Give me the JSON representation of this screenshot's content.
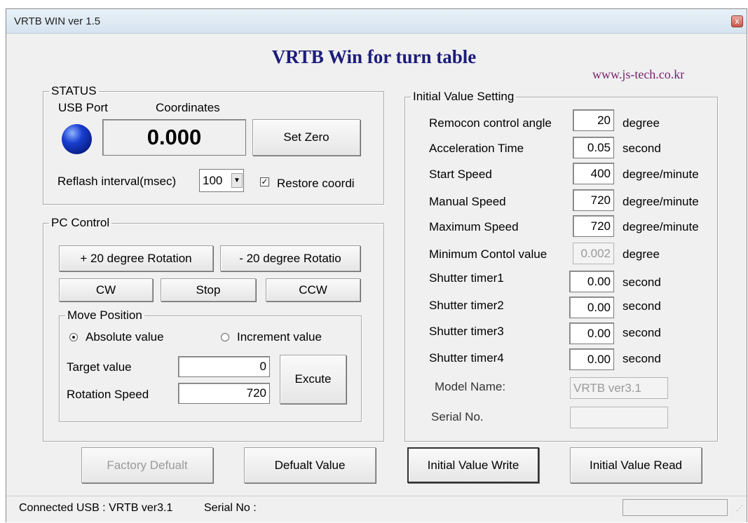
{
  "window": {
    "title": "VRTB WIN  ver 1.5",
    "close_glyph": "x"
  },
  "heading": "VRTB Win for turn table",
  "website": "www.js-tech.co.kr",
  "status": {
    "legend": "STATUS",
    "usb_port_label": "USB Port",
    "coordinates_label": "Coordinates",
    "coordinates_value": "0.000",
    "set_zero_label": "Set Zero",
    "refresh_label": "Reflash interval(msec)",
    "refresh_value": "100",
    "restore_label": "Restore coordi",
    "restore_checked": true,
    "led_color": "#1a3fd0"
  },
  "pc_control": {
    "legend": "PC Control",
    "plus_rotation_label": "+ 20 degree Rotation",
    "minus_rotation_label": "- 20 degree Rotatio",
    "cw_label": "CW",
    "stop_label": "Stop",
    "ccw_label": "CCW",
    "move_position": {
      "legend": "Move Position",
      "absolute_label": "Absolute value",
      "increment_label": "Increment value",
      "selected": "absolute",
      "target_label": "Target value",
      "target_value": "0",
      "speed_label": "Rotation Speed",
      "speed_value": "720",
      "execute_label": "Excute"
    }
  },
  "initial": {
    "legend": "Initial Value Setting",
    "rows": [
      {
        "label": "Remocon control angle",
        "value": "20",
        "unit": "degree"
      },
      {
        "label": "Acceleration Time",
        "value": "0.05",
        "unit": "second"
      },
      {
        "label": "Start Speed",
        "value": "400",
        "unit": "degree/minute"
      },
      {
        "label": "Manual Speed",
        "value": "720",
        "unit": "degree/minute"
      },
      {
        "label": "Maximum Speed",
        "value": "720",
        "unit": "degree/minute"
      },
      {
        "label": "Minimum Contol value",
        "value": "0.002",
        "unit": "degree"
      },
      {
        "label": "Shutter timer1",
        "value": "0.00",
        "unit": "second"
      },
      {
        "label": "Shutter timer2",
        "value": "0.00",
        "unit": "second"
      },
      {
        "label": "Shutter timer3",
        "value": "0.00",
        "unit": "second"
      },
      {
        "label": "Shutter timer4",
        "value": "0.00",
        "unit": "second"
      }
    ],
    "model_label": "Model Name:",
    "model_value": "VRTB   ver3.1",
    "serial_label": "Serial No.",
    "serial_value": ""
  },
  "buttons": {
    "factory_default": "Factory Defualt",
    "default_value": "Defualt Value",
    "write": "Initial Value Write",
    "read": "Initial Value Read"
  },
  "statusbar": {
    "connected": "Connected USB : VRTB ver3.1",
    "serial": "Serial No :"
  }
}
